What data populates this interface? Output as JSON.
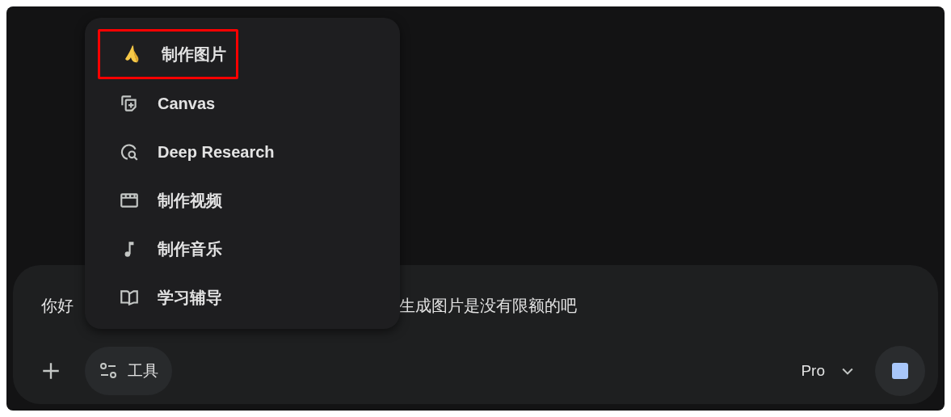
{
  "tools_menu": {
    "items": [
      {
        "label": "制作图片",
        "highlighted": true
      },
      {
        "label": "Canvas",
        "highlighted": false
      },
      {
        "label": "Deep Research",
        "highlighted": false
      },
      {
        "label": "制作视频",
        "highlighted": false
      },
      {
        "label": "制作音乐",
        "highlighted": false
      },
      {
        "label": "学习辅导",
        "highlighted": false
      }
    ]
  },
  "prompt": {
    "text_parts": [
      "你好",
      "生成图片是没有限额的吧"
    ]
  },
  "toolbar": {
    "tools_label": "工具",
    "model": "Pro"
  }
}
